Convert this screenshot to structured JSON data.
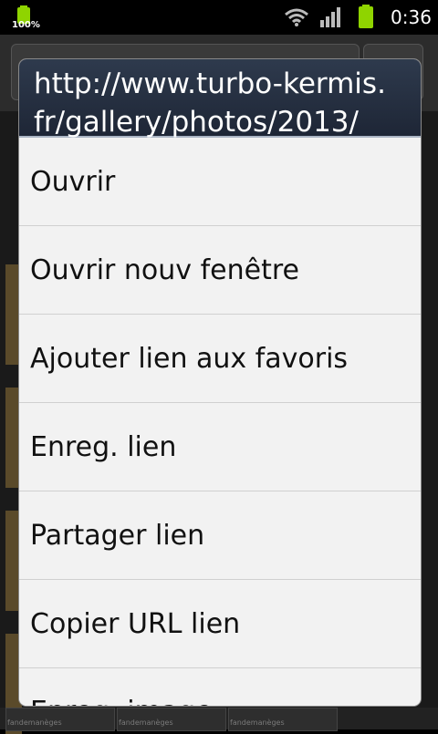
{
  "status_bar": {
    "battery_percent": "100%",
    "time": "0:36",
    "icons": [
      "battery-icon",
      "wifi-icon",
      "signal-icon",
      "battery-icon"
    ]
  },
  "dialog": {
    "title_line1": "http://www.turbo-kermis.",
    "title_line2": "fr/gallery/photos/2013/",
    "items": [
      {
        "label": "Ouvrir"
      },
      {
        "label": "Ouvrir nouv fenêtre"
      },
      {
        "label": "Ajouter lien aux favoris"
      },
      {
        "label": "Enreg. lien"
      },
      {
        "label": "Partager lien"
      },
      {
        "label": "Copier URL lien"
      },
      {
        "label": "Enreg. image"
      }
    ]
  },
  "background": {
    "caption1": "fandemanèges",
    "caption2": "fandemanèges",
    "caption3": "fandemanèges"
  },
  "colors": {
    "dialog_title_bg": "#1e2636",
    "dialog_body_bg": "#f2f2f2",
    "battery_green": "#8fd400"
  }
}
